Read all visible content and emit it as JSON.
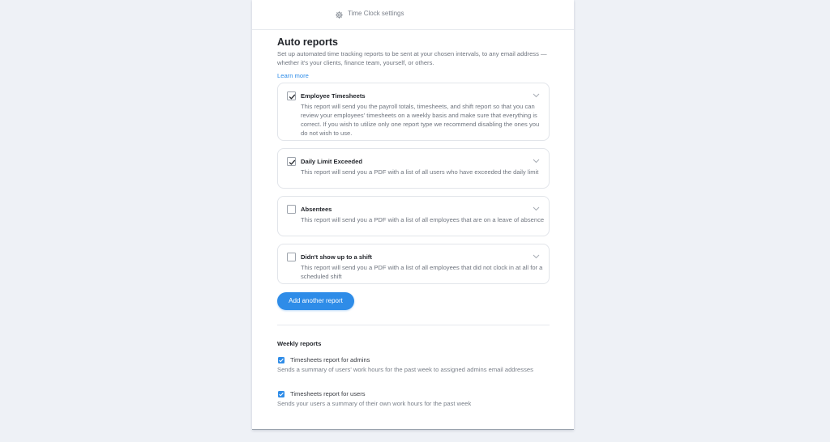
{
  "header": {
    "title": "Time Clock settings",
    "icon": "gear-icon"
  },
  "auto_reports": {
    "title": "Auto reports",
    "description": "Set up automated time tracking reports to be sent at your chosen intervals, to any email address — whether it's your clients, finance team, yourself, or others.",
    "learn_more": "Learn more",
    "reports": [
      {
        "title": "Employee Timesheets",
        "checked": true,
        "description": "This report will send you the payroll totals, timesheets, and shift report so that you can review your employees' timesheets on a weekly basis and make sure that everything is correct. If you wish to utilize only one report type we recommend disabling the ones you do not wish to use."
      },
      {
        "title": "Daily Limit Exceeded",
        "checked": true,
        "description": "This report will send you a PDF with a list of all users who have exceeded the daily limit"
      },
      {
        "title": "Absentees",
        "checked": false,
        "description": "This report will send you a PDF with a list of all employees that are on a leave of absence"
      },
      {
        "title": "Didn't show up to a shift",
        "checked": false,
        "description": "This report will send you a PDF with a list of all employees that did not clock in at all for a scheduled shift"
      }
    ],
    "add_button": "Add another report"
  },
  "weekly_reports": {
    "title": "Weekly reports",
    "items": [
      {
        "title": "Timesheets report for admins",
        "checked": true,
        "description": "Sends a summary of users' work hours for the past week to assigned admins email addresses"
      },
      {
        "title": "Timesheets report for users",
        "checked": true,
        "description": "Sends your users a summary of their own work hours for the past week"
      }
    ]
  },
  "colors": {
    "accent": "#2e8ce8",
    "background": "#eef1f6"
  }
}
